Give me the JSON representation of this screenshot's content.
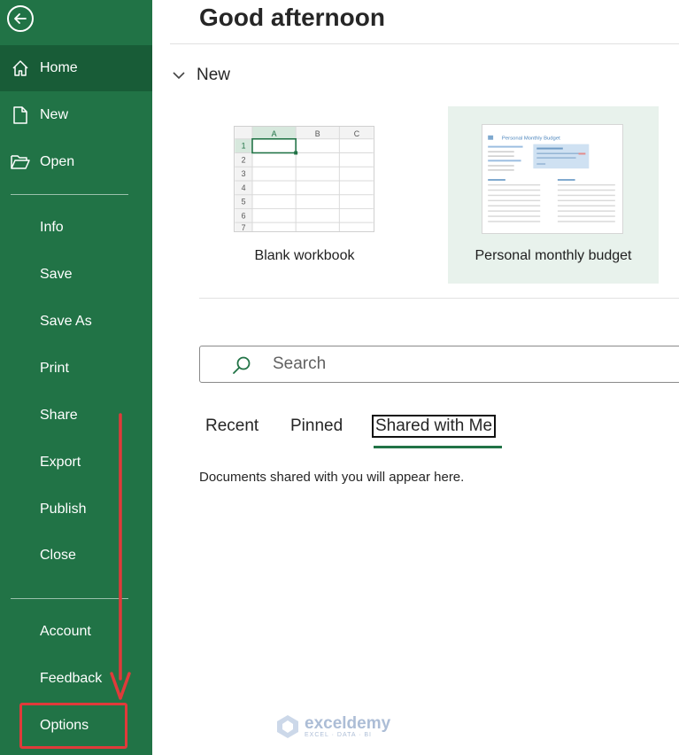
{
  "sidebar": {
    "items": [
      {
        "label": "Home",
        "icon": "home-icon",
        "active": true
      },
      {
        "label": "New",
        "icon": "new-file-icon"
      },
      {
        "label": "Open",
        "icon": "open-folder-icon"
      },
      {
        "label": "Info"
      },
      {
        "label": "Save"
      },
      {
        "label": "Save As"
      },
      {
        "label": "Print"
      },
      {
        "label": "Share"
      },
      {
        "label": "Export"
      },
      {
        "label": "Publish"
      },
      {
        "label": "Close"
      },
      {
        "label": "Account"
      },
      {
        "label": "Feedback"
      },
      {
        "label": "Options",
        "highlighted": true
      }
    ]
  },
  "main": {
    "greeting": "Good afternoon",
    "new_section": {
      "label": "New"
    },
    "templates": [
      {
        "name": "Blank workbook"
      },
      {
        "name": "Personal monthly budget",
        "selected": true
      }
    ],
    "blank_thumb": {
      "columns": [
        "A",
        "B",
        "C"
      ],
      "rows": [
        "1",
        "2",
        "3",
        "4",
        "5",
        "6",
        "7"
      ]
    },
    "budget_thumb": {
      "title": "Personal Monthly Budget"
    },
    "search": {
      "placeholder": "Search"
    },
    "tabs": [
      {
        "label": "Recent"
      },
      {
        "label": "Pinned"
      },
      {
        "label": "Shared with Me",
        "active": true
      }
    ],
    "empty_message": "Documents shared with you will appear here."
  },
  "watermark": {
    "name": "exceldemy",
    "tagline": "EXCEL · DATA · BI"
  },
  "colors": {
    "sidebar": "#217346",
    "active_item": "#185c37",
    "annotation": "#e03a3a",
    "selected_template": "#e8f2ec"
  }
}
